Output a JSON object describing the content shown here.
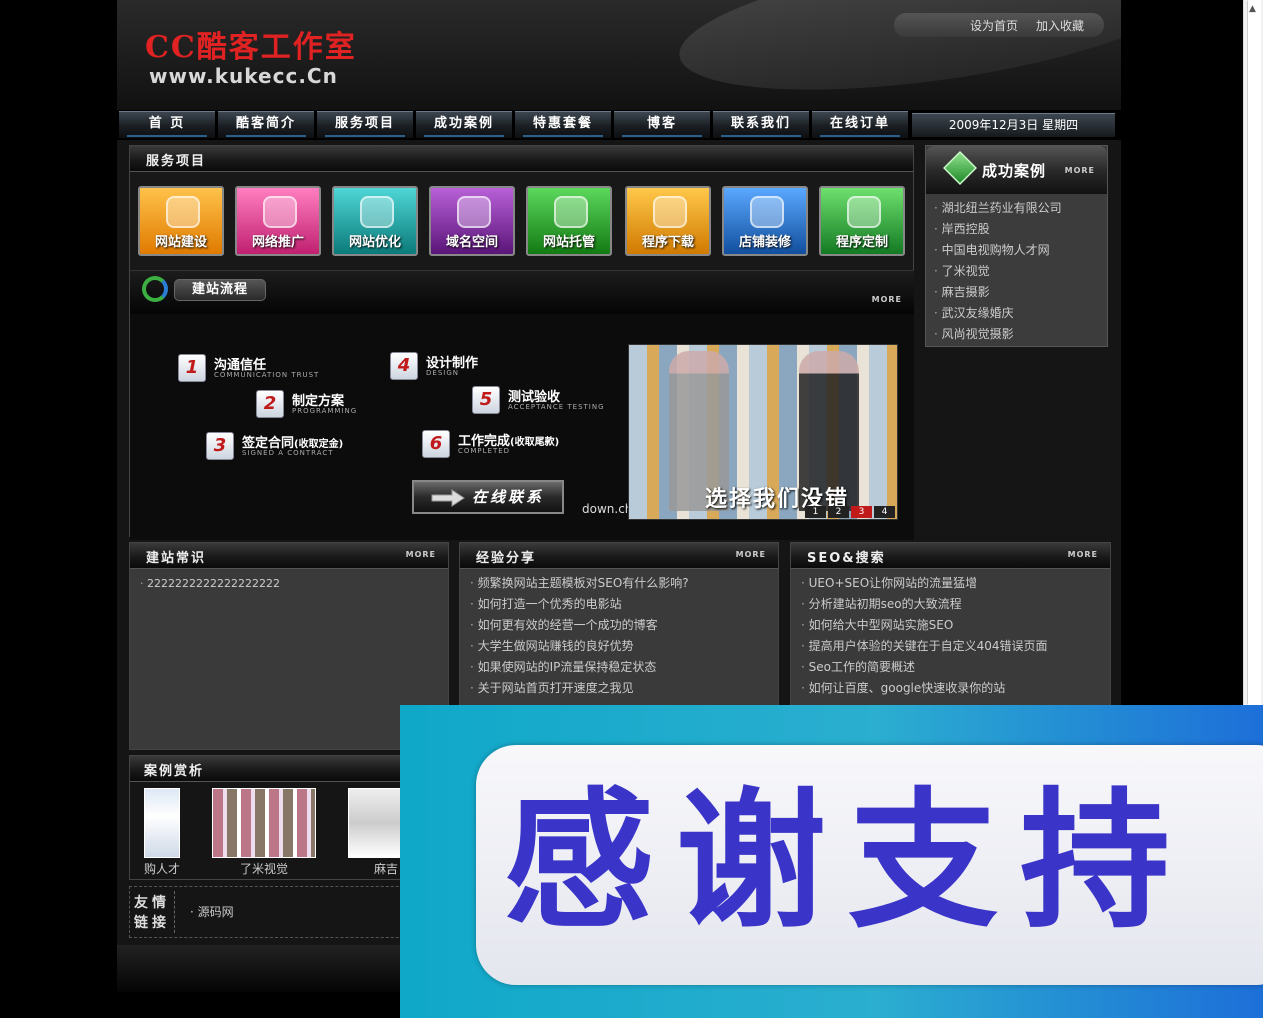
{
  "header": {
    "logo_cn": "CC酷客工作室",
    "logo_url": "www.kukecc.Cn",
    "links": [
      "设为首页",
      "加入收藏"
    ]
  },
  "nav": {
    "items": [
      "首 页",
      "酷客简介",
      "服务项目",
      "成功案例",
      "特惠套餐",
      "博客",
      "联系我们",
      "在线订单"
    ],
    "date": "2009年12月3日 星期四"
  },
  "services": {
    "title": "服务项目",
    "items": [
      {
        "label": "网站建设",
        "color": "#f39a12",
        "icon": "question-icon"
      },
      {
        "label": "网络推广",
        "color": "#e0479a",
        "icon": "folder-icon"
      },
      {
        "label": "网站优化",
        "color": "#1aa6a6",
        "icon": "shield-icon"
      },
      {
        "label": "域名空间",
        "color": "#8a2fa8",
        "icon": "pie-icon"
      },
      {
        "label": "网站托管",
        "color": "#2aa52a",
        "icon": "book-icon"
      },
      {
        "label": "程序下载",
        "color": "#f0a020",
        "icon": "download-icon"
      },
      {
        "label": "店铺装修",
        "color": "#2a7fd4",
        "icon": "gift-icon"
      },
      {
        "label": "程序定制",
        "color": "#3cb043",
        "icon": "gear-icon"
      }
    ]
  },
  "flow": {
    "title": "建站流程",
    "more": "MORE",
    "steps": [
      {
        "num": "1",
        "name": "沟通信任",
        "note": "",
        "en": "COMMUNICATION TRUST"
      },
      {
        "num": "2",
        "name": "制定方案",
        "note": "",
        "en": "PROGRAMMING"
      },
      {
        "num": "3",
        "name": "签定合同",
        "note": "(收取定金)",
        "en": "SIGNED A CONTRACT"
      },
      {
        "num": "4",
        "name": "设计制作",
        "note": "",
        "en": "DESIGN"
      },
      {
        "num": "5",
        "name": "测试验收",
        "note": "",
        "en": "ACCEPTANCE TESTING"
      },
      {
        "num": "6",
        "name": "工作完成",
        "note": "(收取尾款)",
        "en": "COMPLETED"
      }
    ],
    "online_button": "在线联系",
    "watermark": "down.chinaz.com",
    "photo_caption": "选择我们没错",
    "pager": [
      "1",
      "2",
      "3",
      "4"
    ],
    "pager_active": 2
  },
  "cases": {
    "title": "成功案例",
    "more": "MORE",
    "items": [
      "湖北纽兰药业有限公司",
      "岸西控股",
      "中国电视购物人才网",
      "了米视觉",
      "麻吉摄影",
      "武汉友缘婚庆",
      "风尚视觉摄影"
    ]
  },
  "knowledge": {
    "title": "建站常识",
    "more": "MORE",
    "items": [
      "2222222222222222222"
    ]
  },
  "experience": {
    "title": "经验分享",
    "more": "MORE",
    "items": [
      "频繁换网站主题模板对SEO有什么影响?",
      "如何打造一个优秀的电影站",
      "如何更有效的经营一个成功的博客",
      "大学生做网站赚钱的良好优势",
      "如果使网站的IP流量保持稳定状态",
      "关于网站首页打开速度之我见"
    ]
  },
  "seo": {
    "title": "SEO&搜索",
    "more": "MORE",
    "items": [
      "UEO+SEO让你网站的流量猛增",
      "分析建站初期seo的大致流程",
      "如何给大中型网站实施SEO",
      "提高用户体验的关键在于自定义404错误页面",
      "Seo工作的简要概述",
      "如何让百度、google快速收录你的站"
    ]
  },
  "showcase": {
    "title": "案例赏析",
    "items": [
      "购人才",
      "了米视觉",
      "麻吉"
    ]
  },
  "friends": {
    "label": "友情链接",
    "links": [
      "源码网"
    ]
  },
  "overlay": {
    "text": "感谢支持"
  }
}
